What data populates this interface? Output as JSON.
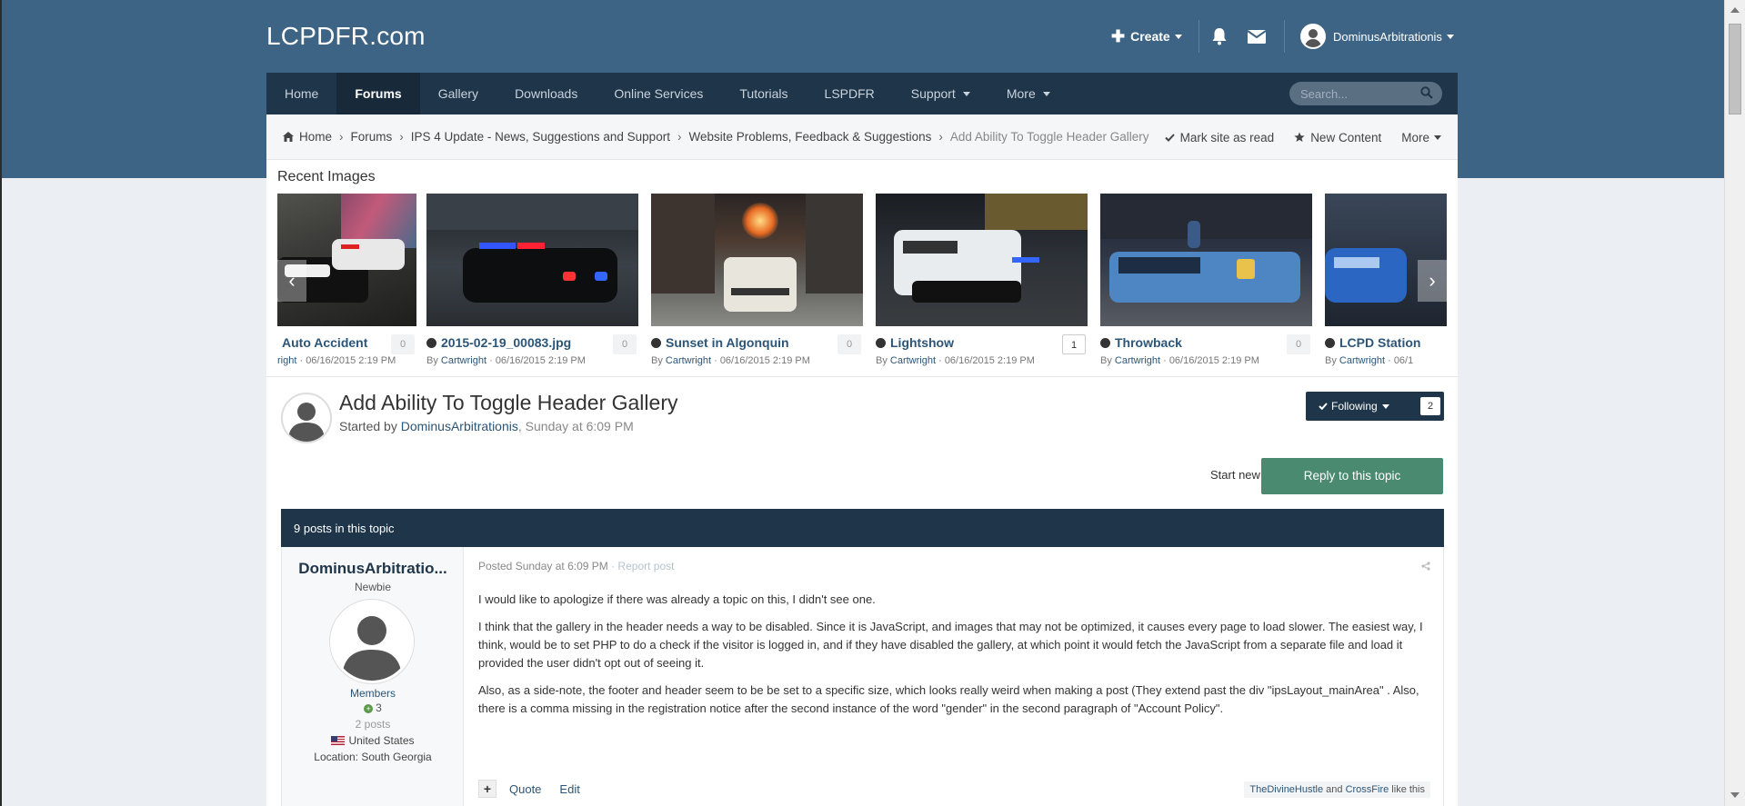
{
  "site": {
    "logo": "LCPDFR.com"
  },
  "user_bar": {
    "create_label": "Create",
    "username": "DominusArbitrationis"
  },
  "nav": {
    "items": [
      {
        "label": "Home",
        "active": false,
        "dropdown": false
      },
      {
        "label": "Forums",
        "active": true,
        "dropdown": false
      },
      {
        "label": "Gallery",
        "active": false,
        "dropdown": false
      },
      {
        "label": "Downloads",
        "active": false,
        "dropdown": false
      },
      {
        "label": "Online Services",
        "active": false,
        "dropdown": false
      },
      {
        "label": "Tutorials",
        "active": false,
        "dropdown": false
      },
      {
        "label": "LSPDFR",
        "active": false,
        "dropdown": false
      },
      {
        "label": "Support",
        "active": false,
        "dropdown": true
      },
      {
        "label": "More",
        "active": false,
        "dropdown": true
      }
    ],
    "search_placeholder": "Search..."
  },
  "breadcrumb": {
    "items": [
      "Home",
      "Forums",
      "IPS 4 Update - News, Suggestions and Support",
      "Website Problems, Feedback & Suggestions",
      "Add Ability To Toggle Header Gallery"
    ],
    "actions": {
      "mark_read": "Mark site as read",
      "new_content": "New Content",
      "more": "More"
    }
  },
  "recent_images": {
    "title": "Recent Images",
    "items": [
      {
        "name": "Auto Accident",
        "by_prefix": "",
        "author": "right",
        "date": "· 06/16/2015 2:19 PM",
        "count": "0",
        "dot": false
      },
      {
        "name": "2015-02-19_00083.jpg",
        "by_prefix": "By ",
        "author": "Cartwright",
        "date": "· 06/16/2015 2:19 PM",
        "count": "0",
        "dot": true
      },
      {
        "name": "Sunset in Algonquin",
        "by_prefix": "By ",
        "author": "Cartwright",
        "date": "· 06/16/2015 2:19 PM",
        "count": "0",
        "dot": true
      },
      {
        "name": "Lightshow",
        "by_prefix": "By ",
        "author": "Cartwright",
        "date": "· 06/16/2015 2:19 PM",
        "count": "1",
        "dot": true
      },
      {
        "name": "Throwback",
        "by_prefix": "By ",
        "author": "Cartwright",
        "date": "· 06/16/2015 2:19 PM",
        "count": "0",
        "dot": true
      },
      {
        "name": "LCPD Station",
        "by_prefix": "By ",
        "author": "Cartwright",
        "date": "· 06/1",
        "count": "",
        "dot": true
      }
    ]
  },
  "topic": {
    "title": "Add Ability To Toggle Header Gallery",
    "started_by": "Started by ",
    "author": "DominusArbitrationis",
    "when": ", Sunday at 6:09 PM",
    "following_label": "Following",
    "following_count": "2",
    "start_new": "Start new topic",
    "reply": "Reply to this topic",
    "posts_count": "9 posts in this topic"
  },
  "post": {
    "author_name": "DominusArbitratio...",
    "rank": "Newbie",
    "group": "Members",
    "reputation": "3",
    "post_count": "2 posts",
    "country": "United States",
    "location": "Location: South Georgia",
    "posted": "Posted Sunday at 6:09 PM",
    "report": " · Report post",
    "paragraphs": [
      "I would like to apologize if there was already a topic on this, I didn't see one.",
      "I think that the gallery in the header needs a way to be disabled. Since it is JavaScript, and images that may not be optimized, it causes every page to load slower. The easiest way, I think, would be to set PHP to do a check if the visitor is logged in, and if they have disabled the gallery, at which point it would fetch the JavaScript from a separate file and load it provided the user didn't opt out of seeing it.",
      "Also, as a side-note, the footer and header seem to be be set to a specific size, which looks really weird when making a post (They extend past the div \"ipsLayout_mainArea\" . Also, there is a comma missing in the registration notice after the second instance of the word \"gender\" in the second paragraph of \"Account Policy\"."
    ],
    "quote": "Quote",
    "edit": "Edit",
    "likers": [
      "TheDivineHustle",
      "CrossFire"
    ],
    "likes_and": " and ",
    "likes_suffix": " like this"
  },
  "colors": {
    "header_bg": "#3e6485",
    "nav_bg": "#1f3549",
    "reply_button": "#4a8a70",
    "link": "#2c5577"
  }
}
